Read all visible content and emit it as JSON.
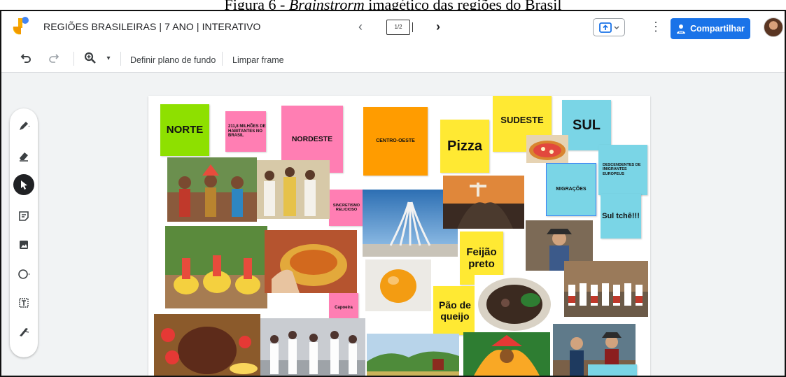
{
  "caption": {
    "prefix": "Figura 6 - ",
    "italic": "Brainstrorm",
    "suffix": " imagético das regiões do Brasil"
  },
  "header": {
    "title": "REGIÕES BRASILEIRAS | 7 ANO | INTERATIVO",
    "frame_indicator": "1/2",
    "share_label": "Compartilhar"
  },
  "toolbar": {
    "background_label": "Definir plano de fundo",
    "clear_label": "Limpar frame"
  },
  "colors": {
    "green": "#8ee000",
    "pink": "#ff7eb3",
    "orange": "#ff9c00",
    "yellow": "#ffe933",
    "cyan": "#7ad5e6",
    "share_blue": "#1a73e8"
  },
  "notes": {
    "norte": "NORTE",
    "habitantes": "211,8 MILHÕES DE HABITANTES NO BRASIL",
    "nordeste": "NORDESTE",
    "centro_oeste": "CENTRO-OESTE",
    "pizza": "Pizza",
    "sudeste": "SUDESTE",
    "sul": "SUL",
    "descendentes": "DESCENDENTES DE IMIGRANTES EUROPEUS",
    "migracoes": "MIGRAÇÕES",
    "sul_tche": "Sul tchê!!!",
    "sincretismo": "SINCRETISMO RELICIOSO",
    "feijao": "Feijão preto",
    "pao": "Pão de queijo",
    "capoeira": "Capoeira"
  },
  "icons": [
    "jamboard-logo",
    "undo-icon",
    "redo-icon",
    "zoom-icon",
    "chevron-down-icon",
    "present-icon",
    "more-vert-icon",
    "person-add-icon",
    "pen-icon",
    "eraser-icon",
    "select-arrow-icon",
    "sticky-note-icon",
    "image-icon",
    "circle-shape-icon",
    "text-box-icon",
    "laser-icon"
  ]
}
